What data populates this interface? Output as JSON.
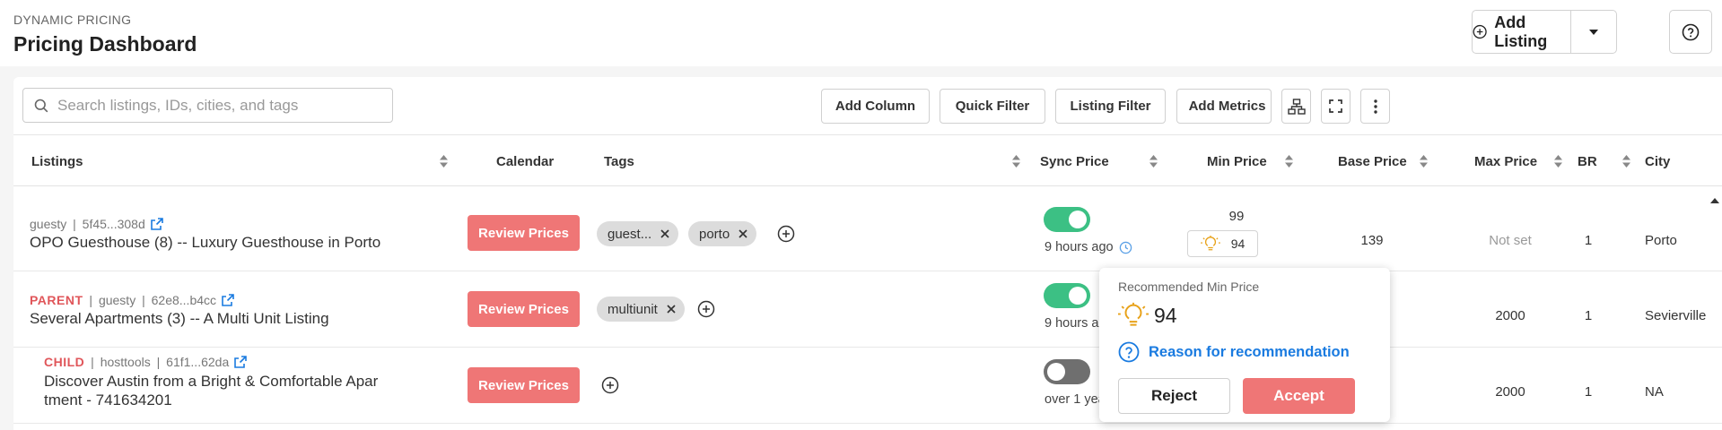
{
  "header": {
    "eyebrow": "DYNAMIC PRICING",
    "title": "Pricing Dashboard",
    "add_listing_label": "Add Listing"
  },
  "toolbar": {
    "search_placeholder": "Search listings, IDs, cities, and tags",
    "add_column": "Add Column",
    "quick_filter": "Quick Filter",
    "listing_filter": "Listing Filter",
    "add_metrics": "Add Metrics"
  },
  "columns": {
    "listings": "Listings",
    "calendar": "Calendar",
    "tags": "Tags",
    "sync_price": "Sync Price",
    "min_price": "Min Price",
    "base_price": "Base Price",
    "max_price": "Max Price",
    "br": "BR",
    "city": "City"
  },
  "rows": [
    {
      "badge": "",
      "source": "guesty",
      "id": "5f45...308d",
      "name_line1": "OPO Guesthouse (8) -- Luxury Guesthouse in Porto",
      "name_line2": "",
      "calendar_button": "Review Prices",
      "tags": [
        "guest...",
        "porto"
      ],
      "sync_on": true,
      "sync_time": "9 hours ago",
      "min_price": "99",
      "min_price_recommended": "94",
      "base_price": "139",
      "max_price": "Not set",
      "br": "1",
      "city": "Porto"
    },
    {
      "badge": "PARENT",
      "source": "guesty",
      "id": "62e8...b4cc",
      "name_line1": "Several Apartments (3) -- A Multi Unit Listing",
      "name_line2": "",
      "calendar_button": "Review Prices",
      "tags": [
        "multiunit"
      ],
      "sync_on": true,
      "sync_time": "9 hours a",
      "min_price": "",
      "base_price": "",
      "max_price": "2000",
      "br": "1",
      "city": "Sevierville"
    },
    {
      "badge": "CHILD",
      "source": "hosttools",
      "id": "61f1...62da",
      "name_line1": "Discover Austin from a Bright & Comfortable Apar",
      "name_line2": "tment - 741634201",
      "calendar_button": "Review Prices",
      "tags": [],
      "sync_on": false,
      "sync_time": "over 1 yea",
      "min_price": "",
      "base_price": "",
      "max_price": "2000",
      "br": "1",
      "city": "NA"
    }
  ],
  "popover": {
    "title": "Recommended Min Price",
    "value": "94",
    "reason_link": "Reason for recommendation",
    "reject": "Reject",
    "accept": "Accept"
  },
  "colors": {
    "accent_red": "#ef7676",
    "toggle_on": "#3cc084",
    "link_blue": "#1a7be0",
    "bulb_orange": "#e8a21a"
  },
  "icons": {
    "search": "search-icon",
    "eye": "eye-icon",
    "filter": "filter-icon",
    "metrics": "chart-icon",
    "hierarchy": "hierarchy-icon",
    "fullscreen": "fullscreen-icon",
    "more": "more-vertical-icon",
    "external": "external-link-icon",
    "bulb": "lightbulb-icon",
    "clock": "clock-icon",
    "help": "help-icon"
  }
}
